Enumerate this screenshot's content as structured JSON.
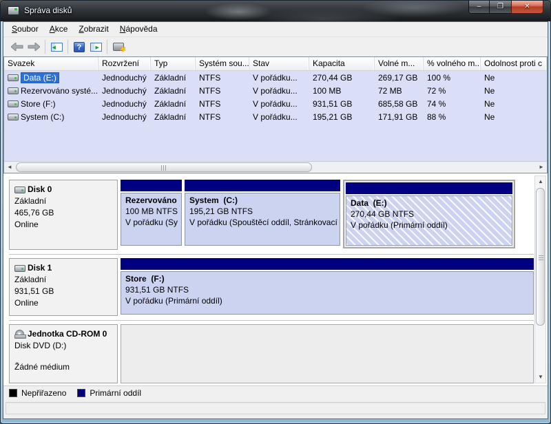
{
  "window": {
    "title": "Správa disků",
    "controls": {
      "minimize": "–",
      "maximize": "❐",
      "close": "✕"
    }
  },
  "menu": {
    "items": [
      {
        "key": "S",
        "rest": "oubor"
      },
      {
        "key": "A",
        "rest": "kce"
      },
      {
        "key": "Z",
        "rest": "obrazit"
      },
      {
        "key": "N",
        "rest": "ápověda"
      }
    ]
  },
  "toolbar": {
    "icons": [
      "back-icon",
      "forward-icon",
      "console-tree-icon",
      "help-icon",
      "show-pane-icon",
      "disk-actions-icon"
    ],
    "help_glyph": "?"
  },
  "volumes": {
    "columns": [
      "Svazek",
      "Rozvržení",
      "Typ",
      "Systém sou...",
      "Stav",
      "Kapacita",
      "Volné m...",
      "% volného m...",
      "Odolnost proti c"
    ],
    "rows": [
      {
        "name": "Data (E:)",
        "layout": "Jednoduchý",
        "type": "Základní",
        "fs": "NTFS",
        "status": "V pořádku...",
        "capacity": "270,44 GB",
        "free": "269,17 GB",
        "pct_free": "100 %",
        "fault_tolerance": "Ne",
        "selected": true
      },
      {
        "name": "Rezervováno systé...",
        "layout": "Jednoduchý",
        "type": "Základní",
        "fs": "NTFS",
        "status": "V pořádku...",
        "capacity": "100 MB",
        "free": "72 MB",
        "pct_free": "72 %",
        "fault_tolerance": "Ne",
        "selected": false
      },
      {
        "name": "Store (F:)",
        "layout": "Jednoduchý",
        "type": "Základní",
        "fs": "NTFS",
        "status": "V pořádku...",
        "capacity": "931,51 GB",
        "free": "685,58 GB",
        "pct_free": "74 %",
        "fault_tolerance": "Ne",
        "selected": false
      },
      {
        "name": "System (C:)",
        "layout": "Jednoduchý",
        "type": "Základní",
        "fs": "NTFS",
        "status": "V pořádku...",
        "capacity": "195,21 GB",
        "free": "171,91 GB",
        "pct_free": "88 %",
        "fault_tolerance": "Ne",
        "selected": false
      }
    ]
  },
  "graph": {
    "disks": [
      {
        "name": "Disk 0",
        "type": "Základní",
        "size": "465,76 GB",
        "status": "Online",
        "partitions": [
          {
            "name": "Rezervováno",
            "size": "100 MB NTFS",
            "status": "V pořádku (Sy",
            "selected": false
          },
          {
            "name": "System  (C:)",
            "size": "195,21 GB NTFS",
            "status": "V pořádku (Spouštěcí oddíl, Stránkovací sc",
            "selected": false
          },
          {
            "name": "Data  (E:)",
            "size": "270,44 GB NTFS",
            "status": "V pořádku (Primární oddíl)",
            "selected": true
          }
        ]
      },
      {
        "name": "Disk 1",
        "type": "Základní",
        "size": "931,51 GB",
        "status": "Online",
        "partitions": [
          {
            "name": "Store  (F:)",
            "size": "931,51 GB NTFS",
            "status": "V pořádku (Primární oddíl)",
            "selected": false
          }
        ]
      },
      {
        "name": "Jednotka CD-ROM 0",
        "type": "Disk DVD (D:)",
        "status": "Žádné médium",
        "partitions": []
      }
    ]
  },
  "legend": {
    "items": [
      {
        "label": "Nepřiřazeno",
        "color": "#000000"
      },
      {
        "label": "Primární oddíl",
        "color": "#000080"
      }
    ]
  },
  "colors": {
    "primary_partition": "#000080",
    "unallocated": "#000000",
    "list_background": "#dadef7",
    "partition_body": "#ccd3f1",
    "selection_highlight": "#2d71d8",
    "close_button": "#b33d26"
  }
}
